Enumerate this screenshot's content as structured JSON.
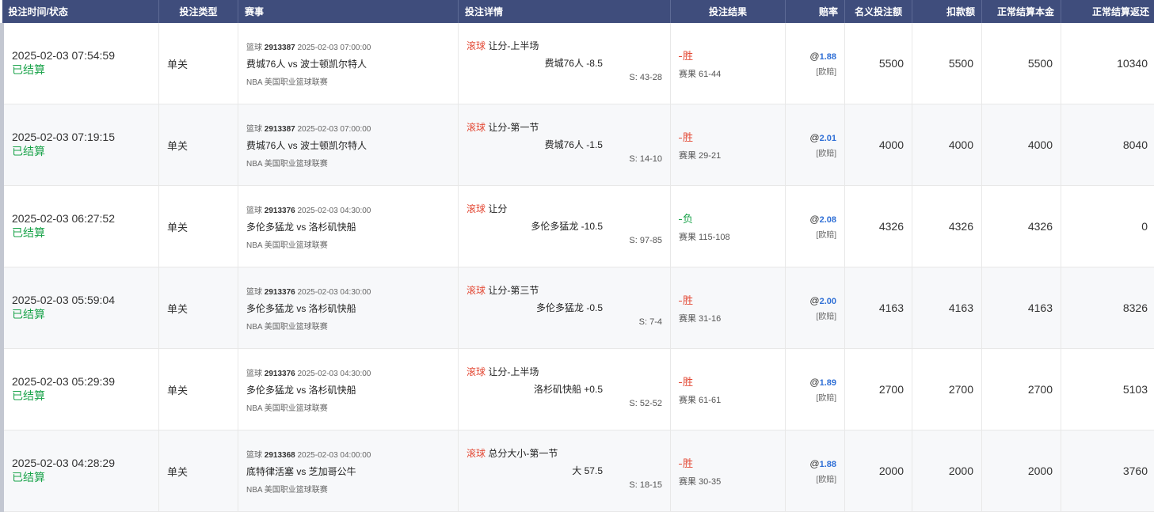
{
  "headers": {
    "time_status": "投注时间/状态",
    "type": "投注类型",
    "event": "赛事",
    "detail": "投注详情",
    "result": "投注结果",
    "odds": "赔率",
    "nominal": "名义投注额",
    "deduct": "扣款额",
    "principal": "正常结算本金",
    "return": "正常结算返还"
  },
  "rows": [
    {
      "time": "2025-02-03 07:54:59",
      "status": "已结算",
      "type": "单关",
      "sport": "篮球",
      "match_id": "2913387",
      "match_time": "2025-02-03 07:00:00",
      "teams": "费城76人 vs 波士顿凯尔特人",
      "league": "NBA 美国职业篮球联赛",
      "roll": "滚球",
      "market": "让分-上半场",
      "pick": "费城76人 -8.5",
      "score": "S: 43-28",
      "result": "胜",
      "result_kind": "win",
      "result_score": "赛果 61-44",
      "odds_at": "@",
      "odds": "1.88",
      "odds_type": "[欧赔]",
      "nominal": "5500",
      "deduct": "5500",
      "principal": "5500",
      "return": "10340"
    },
    {
      "time": "2025-02-03 07:19:15",
      "status": "已结算",
      "type": "单关",
      "sport": "篮球",
      "match_id": "2913387",
      "match_time": "2025-02-03 07:00:00",
      "teams": "费城76人 vs 波士顿凯尔特人",
      "league": "NBA 美国职业篮球联赛",
      "roll": "滚球",
      "market": "让分-第一节",
      "pick": "费城76人 -1.5",
      "score": "S: 14-10",
      "result": "胜",
      "result_kind": "win",
      "result_score": "赛果 29-21",
      "odds_at": "@",
      "odds": "2.01",
      "odds_type": "[欧赔]",
      "nominal": "4000",
      "deduct": "4000",
      "principal": "4000",
      "return": "8040"
    },
    {
      "time": "2025-02-03 06:27:52",
      "status": "已结算",
      "type": "单关",
      "sport": "篮球",
      "match_id": "2913376",
      "match_time": "2025-02-03 04:30:00",
      "teams": "多伦多猛龙 vs 洛杉矶快船",
      "league": "NBA 美国职业篮球联赛",
      "roll": "滚球",
      "market": "让分",
      "pick": "多伦多猛龙 -10.5",
      "score": "S: 97-85",
      "result": "负",
      "result_kind": "lose",
      "result_score": "赛果 115-108",
      "odds_at": "@",
      "odds": "2.08",
      "odds_type": "[欧赔]",
      "nominal": "4326",
      "deduct": "4326",
      "principal": "4326",
      "return": "0"
    },
    {
      "time": "2025-02-03 05:59:04",
      "status": "已结算",
      "type": "单关",
      "sport": "篮球",
      "match_id": "2913376",
      "match_time": "2025-02-03 04:30:00",
      "teams": "多伦多猛龙 vs 洛杉矶快船",
      "league": "NBA 美国职业篮球联赛",
      "roll": "滚球",
      "market": "让分-第三节",
      "pick": "多伦多猛龙 -0.5",
      "score": "S: 7-4",
      "result": "胜",
      "result_kind": "win",
      "result_score": "赛果 31-16",
      "odds_at": "@",
      "odds": "2.00",
      "odds_type": "[欧赔]",
      "nominal": "4163",
      "deduct": "4163",
      "principal": "4163",
      "return": "8326"
    },
    {
      "time": "2025-02-03 05:29:39",
      "status": "已结算",
      "type": "单关",
      "sport": "篮球",
      "match_id": "2913376",
      "match_time": "2025-02-03 04:30:00",
      "teams": "多伦多猛龙 vs 洛杉矶快船",
      "league": "NBA 美国职业篮球联赛",
      "roll": "滚球",
      "market": "让分-上半场",
      "pick": "洛杉矶快船 +0.5",
      "score": "S: 52-52",
      "result": "胜",
      "result_kind": "win",
      "result_score": "赛果 61-61",
      "odds_at": "@",
      "odds": "1.89",
      "odds_type": "[欧赔]",
      "nominal": "2700",
      "deduct": "2700",
      "principal": "2700",
      "return": "5103"
    },
    {
      "time": "2025-02-03 04:28:29",
      "status": "已结算",
      "type": "单关",
      "sport": "篮球",
      "match_id": "2913368",
      "match_time": "2025-02-03 04:00:00",
      "teams": "底特律活塞 vs 芝加哥公牛",
      "league": "NBA 美国职业篮球联赛",
      "roll": "滚球",
      "market": "总分大小-第一节",
      "pick": "大 57.5",
      "score": "S: 18-15",
      "result": "胜",
      "result_kind": "win",
      "result_score": "赛果 30-35",
      "odds_at": "@",
      "odds": "1.88",
      "odds_type": "[欧赔]",
      "nominal": "2000",
      "deduct": "2000",
      "principal": "2000",
      "return": "3760"
    }
  ]
}
